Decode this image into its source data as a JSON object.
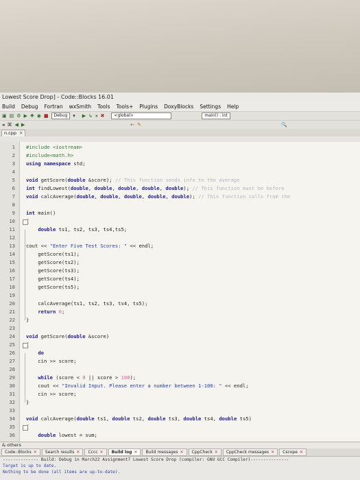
{
  "window": {
    "title": "Lowest Score Drop] - Code::Blocks 16.01"
  },
  "menu": [
    "Build",
    "Debug",
    "Fortran",
    "wxSmith",
    "Tools",
    "Tools+",
    "Plugins",
    "DoxyBlocks",
    "Settings",
    "Help"
  ],
  "toolbar": {
    "build_target": "Debug",
    "scope_combo": "<global>",
    "function_combo": "main() : int"
  },
  "editor_tab": {
    "label": "n.cpp"
  },
  "code_lines": [
    {
      "n": "1",
      "t": "#include <iostream>"
    },
    {
      "n": "2",
      "t": "#include<math.h>"
    },
    {
      "n": "3",
      "t": "using namespace std;"
    },
    {
      "n": "4",
      "t": ""
    },
    {
      "n": "5",
      "t": "void getScore(double &score); // This function sends info to the average"
    },
    {
      "n": "6",
      "t": "int findLowest(double, double, double, double, double); // This function must be before"
    },
    {
      "n": "7",
      "t": "void calcAverage(double, double, double, double, double); // This function calls from the"
    },
    {
      "n": "8",
      "t": ""
    },
    {
      "n": "9",
      "t": "int main()"
    },
    {
      "n": "10",
      "t": "{"
    },
    {
      "n": "11",
      "t": "    double ts1, ts2, ts3, ts4,ts5;"
    },
    {
      "n": "12",
      "t": ""
    },
    {
      "n": "13",
      "t": "cout << \"Enter Five Test Scores: \" << endl;"
    },
    {
      "n": "14",
      "t": "    getScore(ts1);"
    },
    {
      "n": "15",
      "t": "    getScore(ts2);"
    },
    {
      "n": "16",
      "t": "    getScore(ts3);"
    },
    {
      "n": "17",
      "t": "    getScore(ts4);"
    },
    {
      "n": "18",
      "t": "    getScore(ts5);"
    },
    {
      "n": "19",
      "t": ""
    },
    {
      "n": "20",
      "t": "    calcAverage(ts1, ts2, ts3, ts4, ts5);"
    },
    {
      "n": "21",
      "t": "    return 0;"
    },
    {
      "n": "22",
      "t": "}"
    },
    {
      "n": "23",
      "t": ""
    },
    {
      "n": "24",
      "t": "void getScore(double &score)"
    },
    {
      "n": "25",
      "t": "{"
    },
    {
      "n": "26",
      "t": "    do"
    },
    {
      "n": "27",
      "t": "    cin >> score;"
    },
    {
      "n": "28",
      "t": ""
    },
    {
      "n": "29",
      "t": "    while (score < 0 || score > 100);"
    },
    {
      "n": "30",
      "t": "    cout << \"Invalid Input. Please enter a number between 1-100: \" << endl;"
    },
    {
      "n": "31",
      "t": "    cin >> score;"
    },
    {
      "n": "32",
      "t": "}"
    },
    {
      "n": "33",
      "t": ""
    },
    {
      "n": "34",
      "t": "void calcAverage(double ts1, double ts2, double ts3, double ts4, double ts5)"
    },
    {
      "n": "35",
      "t": "{"
    },
    {
      "n": "36",
      "t": "    double lowest = sum;"
    }
  ],
  "logs": {
    "label": "& others",
    "tabs": [
      "Code::Blocks",
      "Search results",
      "Cccc",
      "Build log",
      "Build messages",
      "CppCheck",
      "CppCheck messages",
      "Cscope"
    ],
    "active_tab": "Build log",
    "lines": [
      "-------------- Build: Debug in March22 Assignment7 Lowest Score Drop (compiler: GNU GCC Compiler)---------------",
      "Target is up to date.",
      "Nothing to be done (all items are up-to-date)."
    ]
  },
  "colors": {
    "keyword": "#1a1aa6",
    "string": "#1f3fc0",
    "comment": "#b8b3c4",
    "number": "#e066a0",
    "preprocessor": "#2e7d32",
    "editor_bg": "#f5f4ee"
  }
}
